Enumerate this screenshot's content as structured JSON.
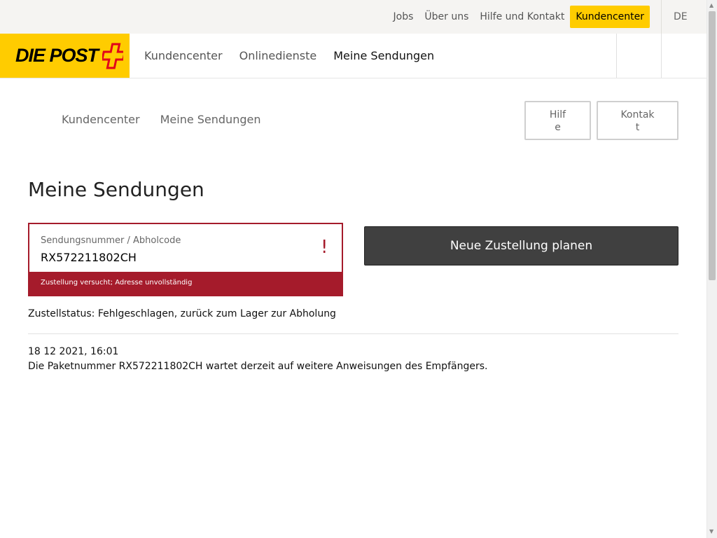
{
  "top_bar": {
    "links": [
      "Jobs",
      "Über uns",
      "Hilfe und Kontakt"
    ],
    "highlight": "Kundencenter",
    "language": "DE"
  },
  "logo": {
    "text": "DIE POST"
  },
  "main_nav": {
    "items": [
      "Kundencenter",
      "Onlinedienste",
      "Meine Sendungen"
    ]
  },
  "breadcrumb": [
    "Kundencenter",
    "Meine Sendungen"
  ],
  "side_buttons": {
    "help": "Hilfe",
    "contact": "Kontakt"
  },
  "page": {
    "title": "Meine Sendungen"
  },
  "tracking_field": {
    "label": "Sendungsnummer / Abholcode",
    "value": "RX572211802CH",
    "error_mark": "!",
    "error_message": "Zustellung versucht; Adresse unvollständig"
  },
  "primary_button": "Neue Zustellung planen",
  "status": "Zustellstatus: Fehlgeschlagen, zurück zum Lager zur Abholung",
  "event": {
    "time": "18 12 2021, 16:01",
    "description": "Die Paketnummer RX572211802CH wartet derzeit auf weitere Anweisungen des Empfängers."
  },
  "colors": {
    "brand_yellow": "#ffcc00",
    "error_red": "#a51b2b",
    "button_dark": "#404040"
  }
}
